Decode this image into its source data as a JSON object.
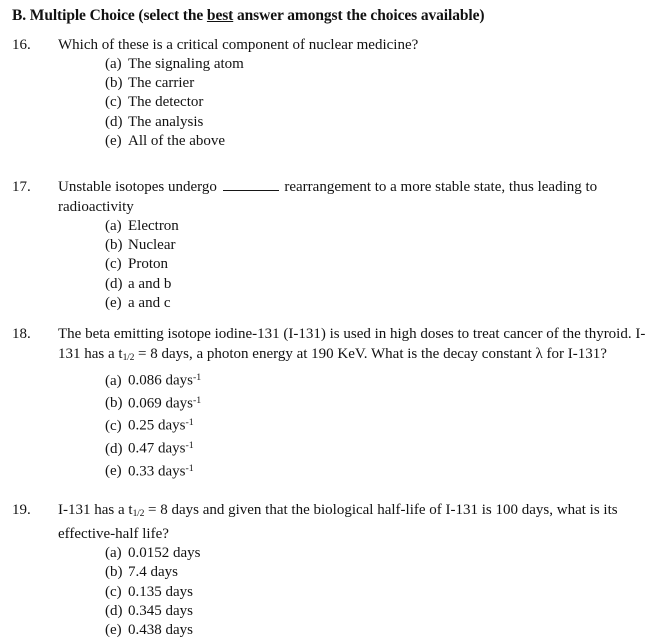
{
  "document": {
    "section_heading": {
      "prefix": "B. Multiple Choice (select the ",
      "emphasis": "best",
      "suffix": " answer amongst the choices available)"
    },
    "questions": [
      {
        "number": "16.",
        "stem": "Which of these is a critical component of nuclear medicine?",
        "options": [
          {
            "label": "(a)",
            "text": "The signaling atom"
          },
          {
            "label": "(b)",
            "text": "The carrier"
          },
          {
            "label": "(c)",
            "text": "The detector"
          },
          {
            "label": "(d)",
            "text": "The analysis"
          },
          {
            "label": "(e)",
            "text": "All of the above"
          }
        ]
      },
      {
        "number": "17.",
        "stem_before_blank": "Unstable isotopes undergo",
        "stem_after_blank": "rearrangement to a more stable state, thus leading to radioactivity",
        "options": [
          {
            "label": "(a)",
            "text": "Electron"
          },
          {
            "label": "(b)",
            "text": "Nuclear"
          },
          {
            "label": "(c)",
            "text": "Proton"
          },
          {
            "label": "(d)",
            "text": "a and b"
          },
          {
            "label": "(e)",
            "text": "a and c"
          }
        ]
      },
      {
        "number": "18.",
        "stem_part1": "The beta emitting isotope iodine-131 (I-131) is used in high doses to treat cancer of the thyroid. I-131 has a t",
        "stem_subscript": "1/2",
        "stem_part2": " = 8 days, a photon energy at 190 KeV. What is the decay constant λ for I-131?",
        "options": [
          {
            "label": "(a)",
            "value": "0.086 days",
            "unit_exponent": "-1"
          },
          {
            "label": "(b)",
            "value": "0.069 days",
            "unit_exponent": "-1"
          },
          {
            "label": "(c)",
            "value": "0.25 days",
            "unit_exponent": "-1"
          },
          {
            "label": "(d)",
            "value": "0.47 days",
            "unit_exponent": "-1"
          },
          {
            "label": "(e)",
            "value": "0.33 days",
            "unit_exponent": "-1"
          }
        ]
      },
      {
        "number": "19.",
        "stem_part1": "I-131 has a t",
        "stem_subscript": "1/2",
        "stem_part2": " = 8 days and given that the biological half-life of I-131 is 100 days, what is its effective-half life?",
        "options": [
          {
            "label": "(a)",
            "text": "0.0152 days"
          },
          {
            "label": "(b)",
            "text": "7.4 days"
          },
          {
            "label": "(c)",
            "text": "0.135 days"
          },
          {
            "label": "(d)",
            "text": "0.345 days"
          },
          {
            "label": "(e)",
            "text": "0.438 days"
          }
        ]
      }
    ]
  }
}
